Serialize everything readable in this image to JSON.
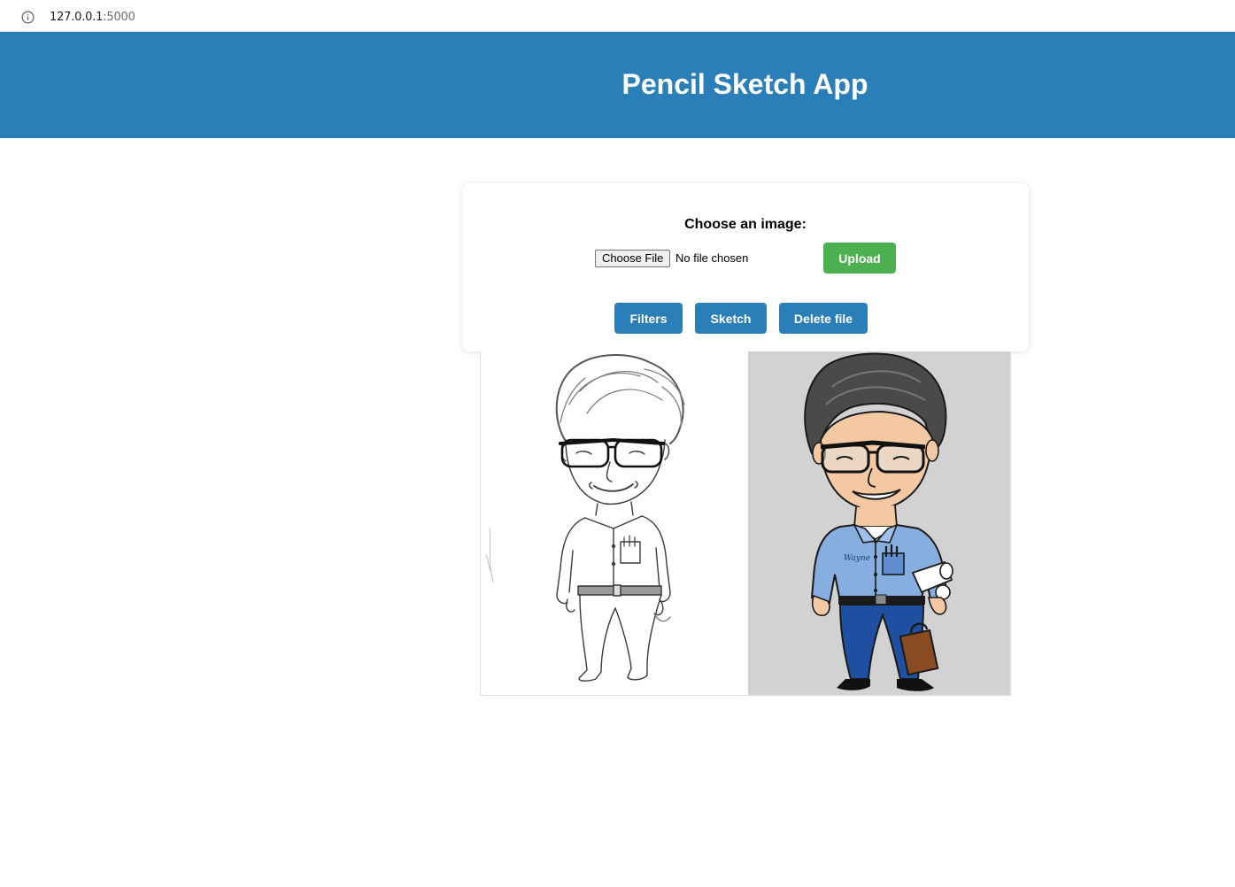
{
  "browser": {
    "url_host": "127.0.0.1",
    "url_port": ":5000",
    "info_icon": "info-icon"
  },
  "header": {
    "title": "Pencil Sketch App",
    "background": "#2a7fb8"
  },
  "upload_card": {
    "label": "Choose an image:",
    "file_button_label": "Choose File",
    "file_status": "No file chosen",
    "upload_label": "Upload",
    "upload_color": "#4caf50"
  },
  "actions": {
    "filters_label": "Filters",
    "sketch_label": "Sketch",
    "delete_label": "Delete file",
    "button_color": "#2a7fb8"
  },
  "result": {
    "sketch_caption": "",
    "shirt_text": "Wayne"
  }
}
